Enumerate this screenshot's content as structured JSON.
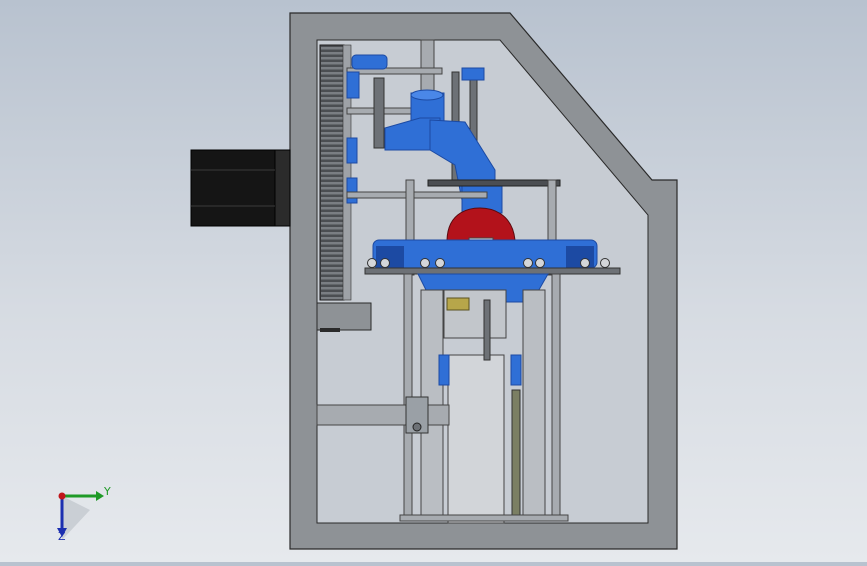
{
  "viewport": {
    "background_top": "#b8c2cf",
    "background_bottom": "#e6e9ed"
  },
  "colors": {
    "frame": "#8e9296",
    "frame_edge": "#2a2a2a",
    "part_blue": "#2f6fd6",
    "part_blue_dark": "#1c4aa3",
    "part_red": "#b3121b",
    "motor_black": "#151515",
    "steel": "#a7abb0",
    "steel_dark": "#6d7176"
  },
  "triad": {
    "y_label": "Y",
    "z_label": "Z",
    "y_color": "#1f9a27",
    "z_color": "#1b2fb0",
    "x_color": "#c0161b"
  }
}
